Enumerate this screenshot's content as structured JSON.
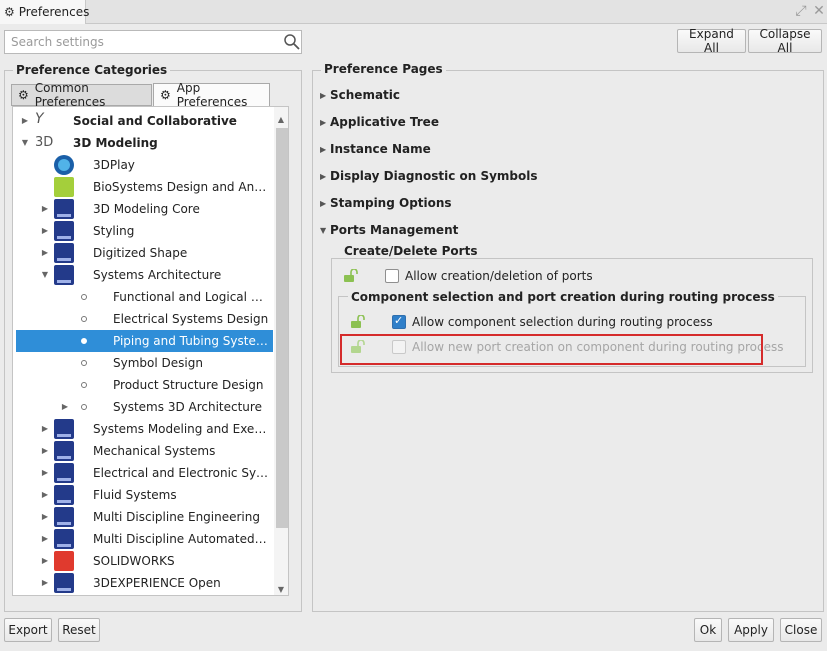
{
  "window": {
    "title": "Preferences"
  },
  "search": {
    "placeholder": "Search settings"
  },
  "buttons": {
    "expand_all": "Expand All",
    "collapse_all": "Collapse All",
    "export": "Export",
    "reset": "Reset",
    "ok": "Ok",
    "apply": "Apply",
    "close": "Close"
  },
  "categories": {
    "title": "Preference Categories",
    "tabs": [
      {
        "label": "Common Preferences"
      },
      {
        "label": "App Preferences"
      }
    ],
    "tree": [
      {
        "label": "Social and Collaborative",
        "bold": true,
        "icon": "y-icon"
      },
      {
        "label": "3D Modeling",
        "bold": true,
        "icon": "3d-icon"
      },
      {
        "label": "3DPlay",
        "icon": "3dplay-icon"
      },
      {
        "label": "BioSystems Design and Analysis",
        "icon": "biosystems-icon"
      },
      {
        "label": "3D Modeling Core",
        "icon": "catia-icon"
      },
      {
        "label": "Styling",
        "icon": "catia-icon"
      },
      {
        "label": "Digitized Shape",
        "icon": "catia-icon"
      },
      {
        "label": "Systems Architecture",
        "icon": "catia-icon"
      },
      {
        "label": "Functional and Logical Des...",
        "icon": "bullet-icon"
      },
      {
        "label": "Electrical Systems Design",
        "icon": "bullet-icon"
      },
      {
        "label": "Piping and Tubing System...",
        "icon": "bullet-icon",
        "selected": true
      },
      {
        "label": "Symbol Design",
        "icon": "bullet-icon"
      },
      {
        "label": "Product Structure Design",
        "icon": "bullet-icon"
      },
      {
        "label": "Systems 3D Architecture",
        "icon": "bullet-icon"
      },
      {
        "label": "Systems Modeling and Execut...",
        "icon": "catia-icon"
      },
      {
        "label": "Mechanical Systems",
        "icon": "catia-icon"
      },
      {
        "label": "Electrical and Electronic Systems",
        "icon": "catia-icon"
      },
      {
        "label": "Fluid Systems",
        "icon": "catia-icon"
      },
      {
        "label": "Multi Discipline Engineering",
        "icon": "catia-icon"
      },
      {
        "label": "Multi Discipline Automated En...",
        "icon": "catia-icon"
      },
      {
        "label": "SOLIDWORKS",
        "icon": "solidworks-icon"
      },
      {
        "label": "3DEXPERIENCE Open",
        "icon": "catia-icon"
      }
    ]
  },
  "pages": {
    "title": "Preference Pages",
    "items": [
      {
        "label": "Schematic",
        "expanded": false
      },
      {
        "label": "Applicative Tree",
        "expanded": false
      },
      {
        "label": "Instance Name",
        "expanded": false
      },
      {
        "label": "Display Diagnostic on Symbols",
        "expanded": false
      },
      {
        "label": "Stamping Options",
        "expanded": false
      },
      {
        "label": "Ports Management",
        "expanded": true
      }
    ],
    "ports": {
      "create_delete_title": "Create/Delete Ports",
      "allow_creation_deletion": {
        "label": "Allow creation/deletion of ports",
        "checked": false
      },
      "component_selection_title": "Component selection and port creation during routing process",
      "allow_component_selection": {
        "label": "Allow component selection during routing process",
        "checked": true
      },
      "allow_new_port": {
        "label": "Allow new port creation on component during routing process",
        "checked": false,
        "disabled": true
      }
    }
  },
  "colors": {
    "selection": "#2f8ed8",
    "highlight": "#d52b2b",
    "check": "#2f7fc9"
  }
}
